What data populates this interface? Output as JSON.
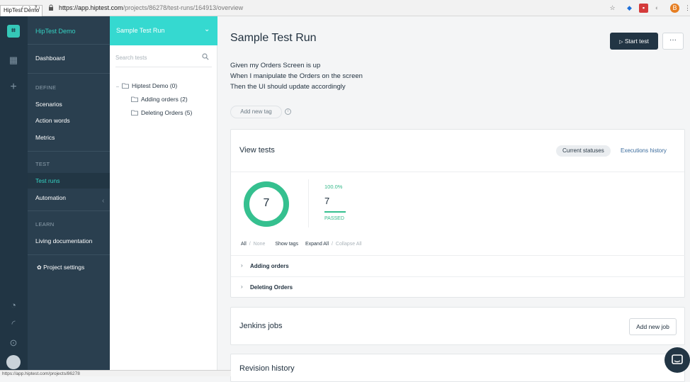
{
  "browser": {
    "tab_title": "HipTest Demo",
    "url_host": "https://app.hiptest.com",
    "url_path": "/projects/86278/test-runs/164913/overview",
    "status_url": "https://app.hiptest.com/projects/86278"
  },
  "colors": {
    "accent": "#35d9d0",
    "passed": "#35c08f",
    "dark": "#223544"
  },
  "rail": {
    "icons": [
      "dashboard-grid-icon",
      "plus-icon",
      "bell-icon",
      "rss-icon",
      "help-icon"
    ]
  },
  "sidebar": {
    "project": "HipTest Demo",
    "dashboard": "Dashboard",
    "sections": {
      "define": "DEFINE",
      "test": "TEST",
      "learn": "LEARN"
    },
    "items": {
      "scenarios": "Scenarios",
      "action_words": "Action words",
      "metrics": "Metrics",
      "test_runs": "Test runs",
      "automation": "Automation",
      "living_doc": "Living documentation",
      "project_settings": "Project settings"
    }
  },
  "tree": {
    "header": "Sample Test Run",
    "search_placeholder": "Search tests",
    "root": "Hiptest Demo (0)",
    "children": [
      "Adding orders (2)",
      "Deleting Orders (5)"
    ]
  },
  "main": {
    "title": "Sample Test Run",
    "start_button": "Start test",
    "more_button": "···",
    "description": [
      "Given my Orders Screen is up",
      "When I manipulate the Orders on the screen",
      "Then the UI should update accordingly"
    ],
    "add_tag": "Add new tag",
    "view_tests": {
      "title": "View tests",
      "tab_current": "Current statuses",
      "tab_history": "Executions history",
      "total": "7",
      "passed_pct": "100.0%",
      "passed_fraction": 1.0,
      "passed_count": "7",
      "passed_label": "PASSED",
      "filters": {
        "all": "All",
        "none": "None",
        "show_tags": "Show tags",
        "expand_all": "Expand All",
        "collapse_all": "Collapse All"
      },
      "folders": [
        "Adding orders",
        "Deleting Orders"
      ]
    },
    "jenkins": {
      "title": "Jenkins jobs",
      "add_button": "Add new job"
    },
    "revision": {
      "title": "Revision history"
    }
  }
}
